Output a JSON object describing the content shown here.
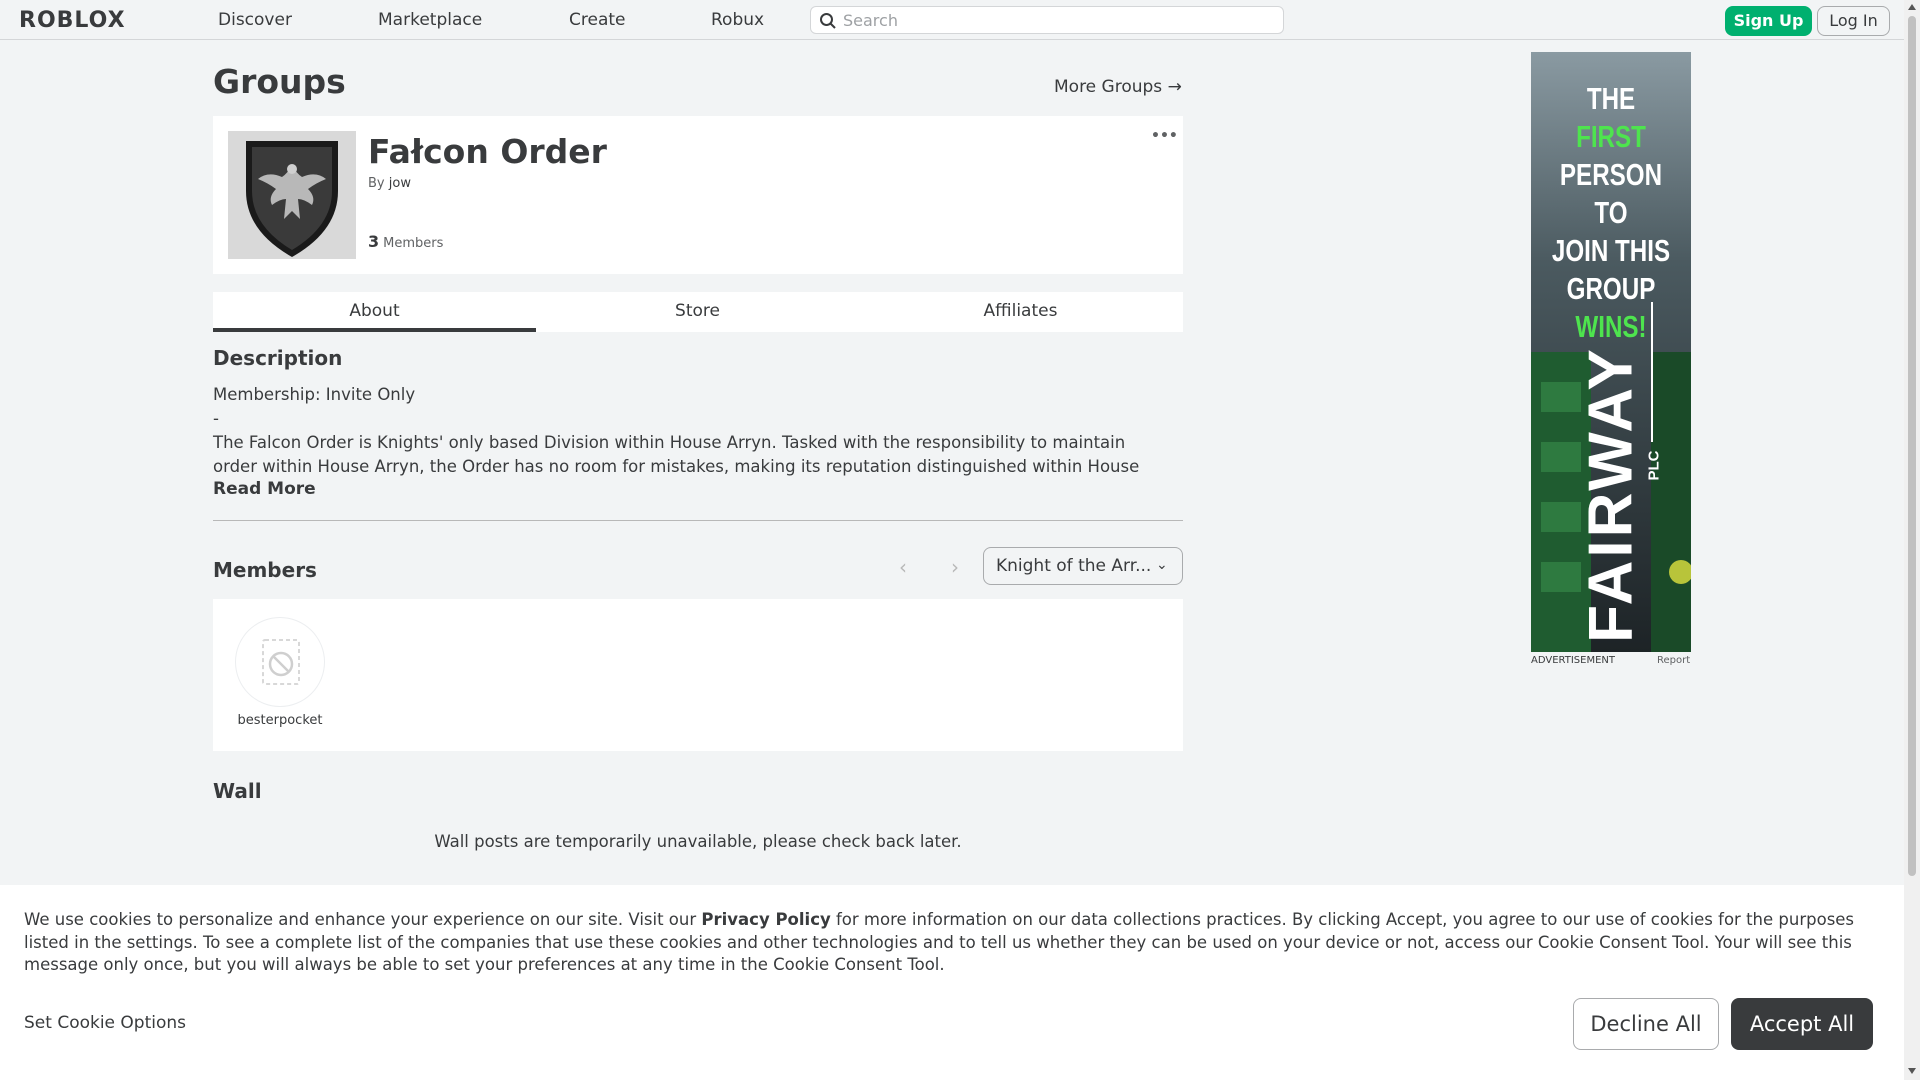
{
  "nav": {
    "logo": "ROBLOX",
    "links": [
      "Discover",
      "Marketplace",
      "Create",
      "Robux"
    ],
    "search_placeholder": "Search",
    "signup_label": "Sign Up",
    "login_label": "Log In"
  },
  "page": {
    "title": "Groups",
    "more_groups": "More Groups →"
  },
  "group": {
    "name": "Fałcon Order",
    "by_prefix": "By",
    "owner": "jow",
    "member_count": "3",
    "members_label": "Members",
    "more_menu": "•••"
  },
  "tabs": [
    "About",
    "Store",
    "Affiliates"
  ],
  "description": {
    "heading": "Description",
    "line1": "Membership: Invite Only",
    "line2": "-",
    "line3": "The Falcon Order is Knights' only based Division within House Arryn. Tasked with the responsibility to maintain",
    "line4": "order within House Arryn, the Order has no room for mistakes, making its reputation distinguished within House",
    "read_more": "Read More"
  },
  "members": {
    "heading": "Members",
    "role_selected": "Knight of the Arr...",
    "list": [
      {
        "name": "besterpocket"
      }
    ]
  },
  "wall": {
    "heading": "Wall",
    "message": "Wall posts are temporarily unavailable, please check back later."
  },
  "ad": {
    "line1a": "THE ",
    "line1b": "FIRST",
    "line2": "PERSON TO",
    "line3": "JOIN THIS",
    "line4": "GROUP",
    "line5": "WINS!",
    "brand": "FAIRWAY",
    "brand_suffix": "PLC",
    "label": "ADVERTISEMENT",
    "report": "Report",
    "highlight_color": "#4ee44e"
  },
  "cookie": {
    "text_before": "We use cookies to personalize and enhance your experience on our site. Visit our ",
    "privacy_link": "Privacy Policy",
    "text_after": " for more information on our data collections practices. By clicking Accept, you agree to our use of cookies for the purposes listed in the settings. To see a complete list of the companies that use these cookies and other technologies and to tell us whether they can be used on your device or not, access our Cookie Consent Tool. Your will see this message only once, but you will always be able to set your preferences at any time in the Cookie Consent Tool.",
    "set_options": "Set Cookie Options",
    "decline": "Decline All",
    "accept": "Accept All"
  },
  "colors": {
    "signup_green": "#00b06f",
    "text": "#393b3d",
    "background": "#f2f4f5"
  }
}
